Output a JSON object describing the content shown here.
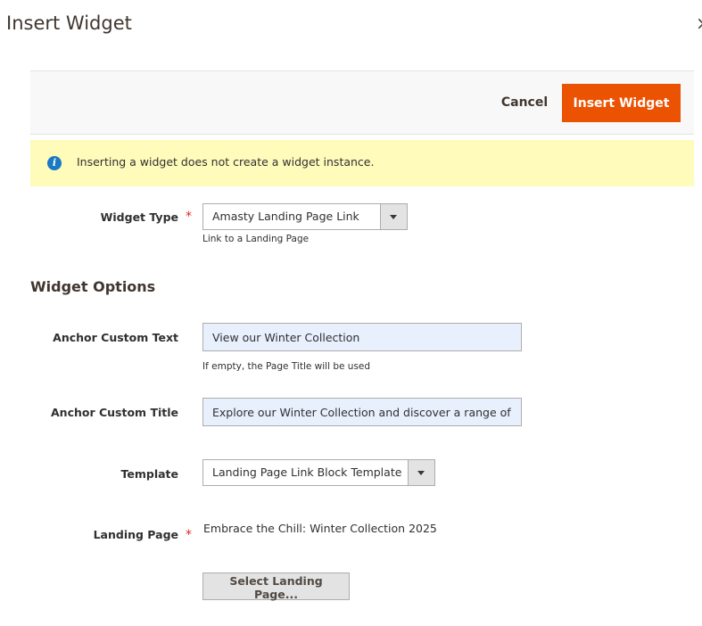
{
  "modal": {
    "title": "Insert Widget",
    "close_icon": "close-icon"
  },
  "toolbar": {
    "cancel_label": "Cancel",
    "insert_label": "Insert Widget"
  },
  "notice": {
    "icon": "info-icon",
    "text": "Inserting a widget does not create a widget instance."
  },
  "widget_type": {
    "label": "Widget Type",
    "required": "*",
    "value": "Amasty Landing Page Link",
    "note": "Link to a Landing Page"
  },
  "options": {
    "title": "Widget Options",
    "anchor_text": {
      "label": "Anchor Custom Text",
      "value": "View our Winter Collection",
      "note": "If empty, the Page Title will be used"
    },
    "anchor_title": {
      "label": "Anchor Custom Title",
      "value": "Explore our Winter Collection and discover a range of stylish"
    },
    "template": {
      "label": "Template",
      "value": "Landing Page Link Block Template"
    },
    "landing_page": {
      "label": "Landing Page",
      "required": "*",
      "value": "Embrace the Chill: Winter Collection 2025",
      "button_label": "Select Landing Page..."
    }
  },
  "colors": {
    "accent": "#eb5202",
    "notice_bg": "#fffbbb",
    "info_blue": "#1979c3",
    "required_red": "#e22626",
    "input_autofill_bg": "#e8f0fe"
  }
}
